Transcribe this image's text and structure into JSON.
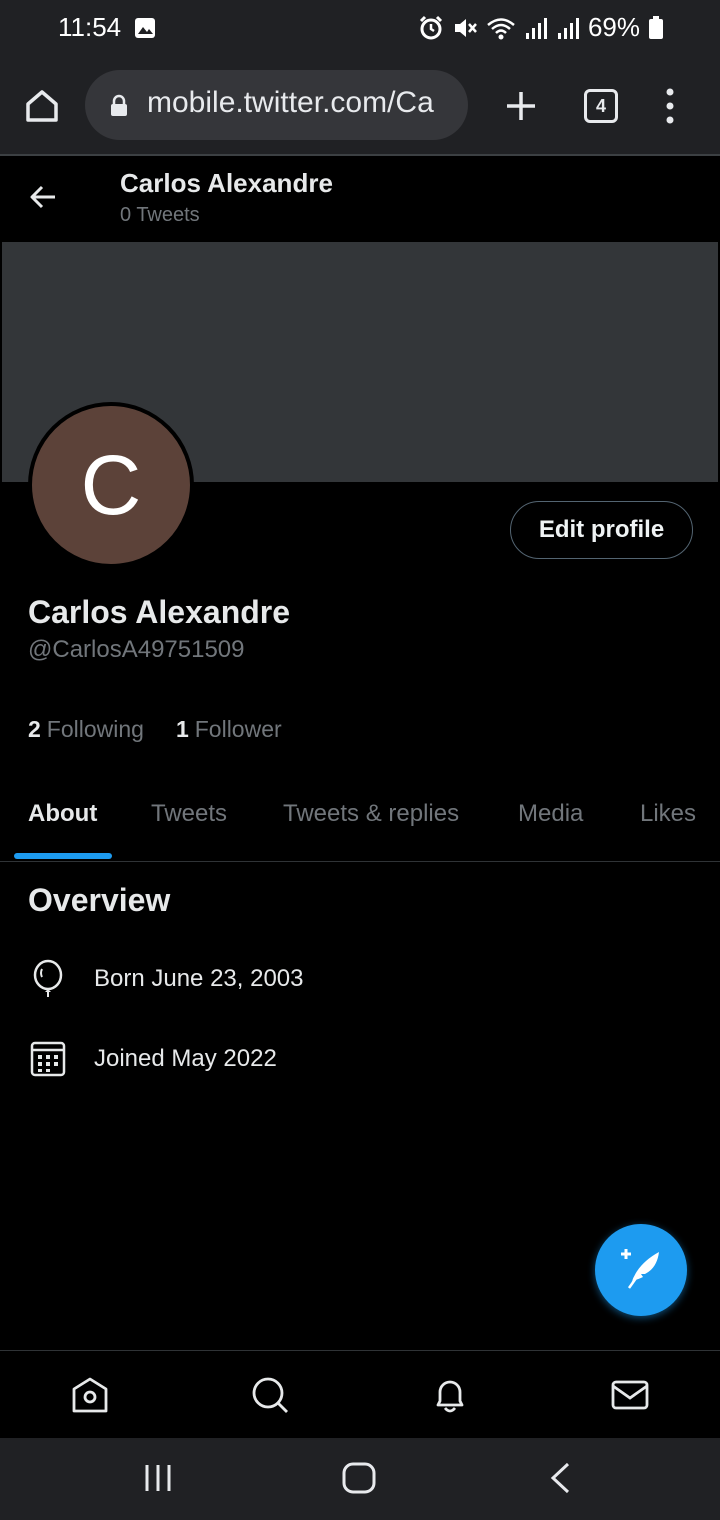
{
  "status_bar": {
    "time": "11:54",
    "battery": "69%"
  },
  "browser": {
    "url": "mobile.twitter.com/Ca",
    "tab_count": "4"
  },
  "header": {
    "name": "Carlos Alexandre",
    "tweet_count": "0 Tweets"
  },
  "profile": {
    "avatar_letter": "C",
    "edit_label": "Edit profile",
    "name": "Carlos Alexandre",
    "handle": "@CarlosA49751509",
    "following_count": "2",
    "following_label": "Following",
    "followers_count": "1",
    "followers_label": "Follower"
  },
  "tabs": [
    {
      "label": "About"
    },
    {
      "label": "Tweets"
    },
    {
      "label": "Tweets & replies"
    },
    {
      "label": "Media"
    },
    {
      "label": "Likes"
    }
  ],
  "about": {
    "heading": "Overview",
    "born": "Born June 23, 2003",
    "joined": "Joined May 2022"
  },
  "colors": {
    "accent": "#1d9bf0",
    "avatar_bg": "#5c4239",
    "banner_bg": "#333639"
  }
}
